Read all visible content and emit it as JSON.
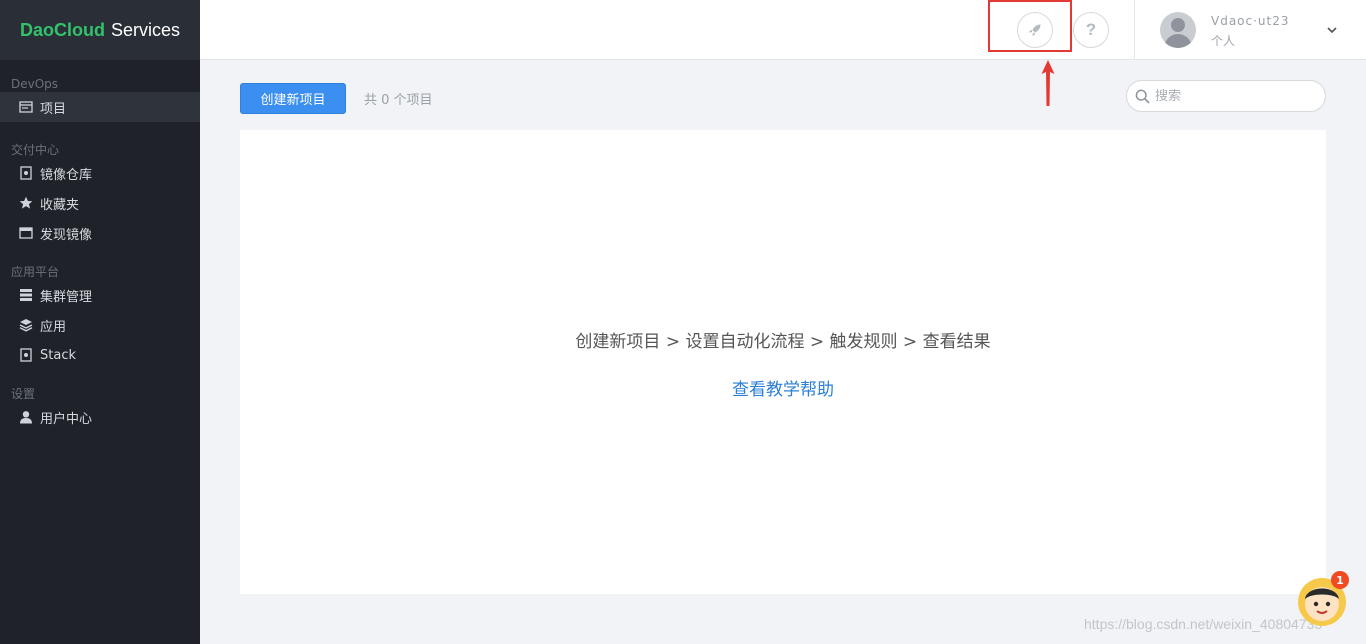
{
  "brand": {
    "part1": "DaoCloud",
    "part2": "Services"
  },
  "sidebar": {
    "sections": [
      {
        "title": "DevOps",
        "items": [
          {
            "label": "项目",
            "icon": "project-icon",
            "active": true
          }
        ]
      },
      {
        "title": "交付中心",
        "items": [
          {
            "label": "镜像仓库",
            "icon": "image-repo-icon"
          },
          {
            "label": "收藏夹",
            "icon": "star-icon"
          },
          {
            "label": "发现镜像",
            "icon": "discover-icon"
          }
        ]
      },
      {
        "title": "应用平台",
        "items": [
          {
            "label": "集群管理",
            "icon": "cluster-icon"
          },
          {
            "label": "应用",
            "icon": "layers-icon"
          },
          {
            "label": "Stack",
            "icon": "stack-icon"
          }
        ]
      },
      {
        "title": "设置",
        "items": [
          {
            "label": "用户中心",
            "icon": "user-icon"
          }
        ]
      }
    ]
  },
  "header": {
    "rocket_icon": "rocket-icon",
    "help_icon": "question-icon",
    "user": {
      "name": "Vdaoc·ut23",
      "type": "个人"
    }
  },
  "toolbar": {
    "create_label": "创建新项目",
    "count_text": "共 0 个项目",
    "search_placeholder": "搜索"
  },
  "main": {
    "steps": "创建新项目 > 设置自动化流程 > 触发规则 > 查看结果",
    "help_link": "查看教学帮助"
  },
  "footer": {
    "watermark": "https://blog.csdn.net/weixin_40804733",
    "badge_count": "1"
  },
  "colors": {
    "accent": "#3a8ff0",
    "brand_green": "#33c26b",
    "sidebar_bg": "#1f2229",
    "highlight": "#e53935"
  }
}
